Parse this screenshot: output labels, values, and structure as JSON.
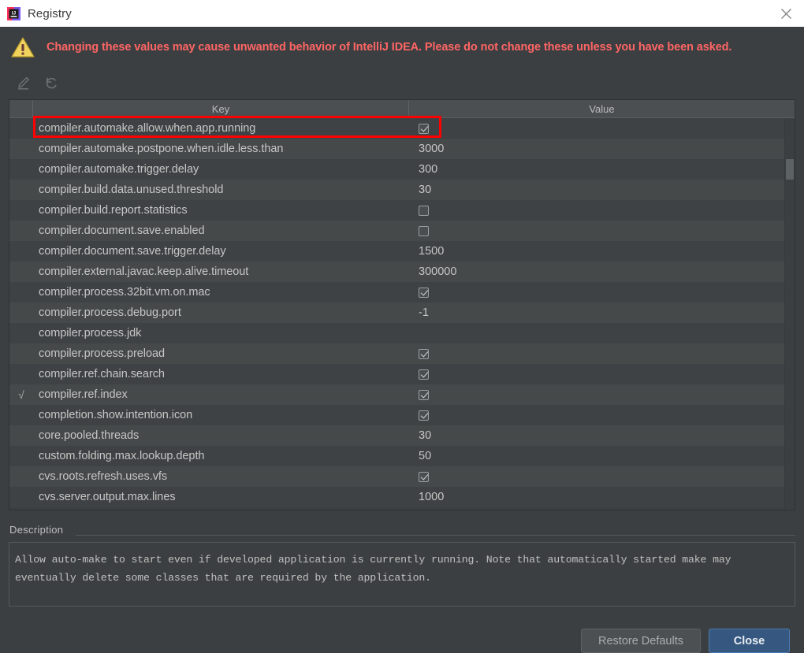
{
  "window": {
    "title": "Registry",
    "app_icon": "intellij-idea-icon",
    "close_icon": "close-icon"
  },
  "banner": {
    "icon": "warning-triangle-icon",
    "message": "Changing these values may cause unwanted behavior of IntelliJ IDEA. Please do not change these unless you have been asked.",
    "color": "#ff6565"
  },
  "toolbar": {
    "buttons": [
      {
        "name": "edit-value-button",
        "icon": "pencil-edit-icon"
      },
      {
        "name": "revert-value-button",
        "icon": "undo-revert-icon"
      }
    ]
  },
  "table": {
    "headers": {
      "flag": "",
      "key": "Key",
      "value": "Value"
    },
    "rows": [
      {
        "flag": "",
        "key": "compiler.automake.allow.when.app.running",
        "type": "checkbox",
        "checked": true,
        "value": ""
      },
      {
        "flag": "",
        "key": "compiler.automake.postpone.when.idle.less.than",
        "type": "text",
        "checked": false,
        "value": "3000"
      },
      {
        "flag": "",
        "key": "compiler.automake.trigger.delay",
        "type": "text",
        "checked": false,
        "value": "300"
      },
      {
        "flag": "",
        "key": "compiler.build.data.unused.threshold",
        "type": "text",
        "checked": false,
        "value": "30"
      },
      {
        "flag": "",
        "key": "compiler.build.report.statistics",
        "type": "checkbox",
        "checked": false,
        "value": ""
      },
      {
        "flag": "",
        "key": "compiler.document.save.enabled",
        "type": "checkbox",
        "checked": false,
        "value": ""
      },
      {
        "flag": "",
        "key": "compiler.document.save.trigger.delay",
        "type": "text",
        "checked": false,
        "value": "1500"
      },
      {
        "flag": "",
        "key": "compiler.external.javac.keep.alive.timeout",
        "type": "text",
        "checked": false,
        "value": "300000"
      },
      {
        "flag": "",
        "key": "compiler.process.32bit.vm.on.mac",
        "type": "checkbox",
        "checked": true,
        "value": ""
      },
      {
        "flag": "",
        "key": "compiler.process.debug.port",
        "type": "text",
        "checked": false,
        "value": "-1"
      },
      {
        "flag": "",
        "key": "compiler.process.jdk",
        "type": "text",
        "checked": false,
        "value": ""
      },
      {
        "flag": "",
        "key": "compiler.process.preload",
        "type": "checkbox",
        "checked": true,
        "value": ""
      },
      {
        "flag": "",
        "key": "compiler.ref.chain.search",
        "type": "checkbox",
        "checked": true,
        "value": ""
      },
      {
        "flag": "√",
        "key": "compiler.ref.index",
        "type": "checkbox",
        "checked": true,
        "value": ""
      },
      {
        "flag": "",
        "key": "completion.show.intention.icon",
        "type": "checkbox",
        "checked": true,
        "value": ""
      },
      {
        "flag": "",
        "key": "core.pooled.threads",
        "type": "text",
        "checked": false,
        "value": "30"
      },
      {
        "flag": "",
        "key": "custom.folding.max.lookup.depth",
        "type": "text",
        "checked": false,
        "value": "50"
      },
      {
        "flag": "",
        "key": "cvs.roots.refresh.uses.vfs",
        "type": "checkbox",
        "checked": true,
        "value": ""
      },
      {
        "flag": "",
        "key": "cvs.server.output.max.lines",
        "type": "text",
        "checked": false,
        "value": "1000"
      }
    ],
    "annotation": {
      "target_row": 0,
      "color": "#ff0000"
    }
  },
  "description": {
    "label": "Description",
    "text": "Allow auto-make to start even if developed application is currently running. Note that automatically started make may eventually delete some classes that are required by the application."
  },
  "footer": {
    "restore_defaults_label": "Restore Defaults",
    "close_label": "Close",
    "close_color": "#365880"
  }
}
